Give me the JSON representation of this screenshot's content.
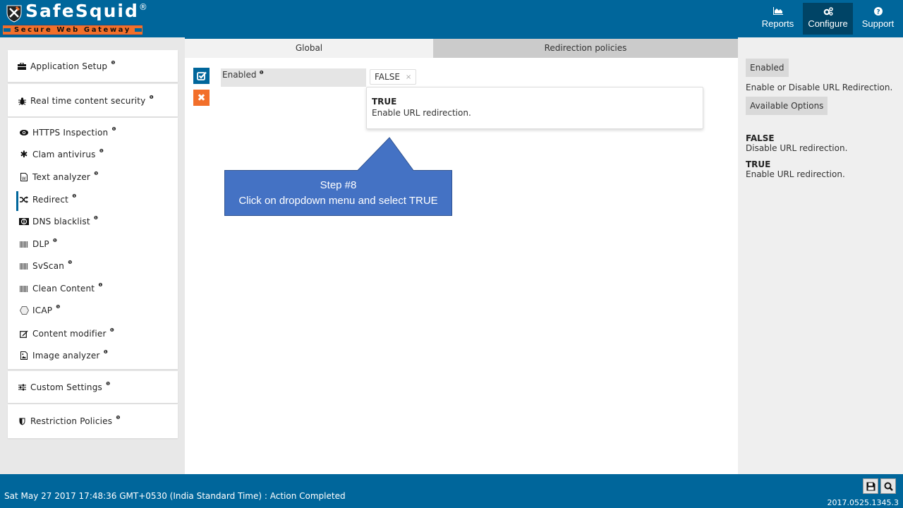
{
  "header": {
    "brand": "SafeSquid",
    "brand_mark": "®",
    "tagline": "Secure Web Gateway",
    "nav": [
      {
        "label": "Reports",
        "icon": "area-chart-icon"
      },
      {
        "label": "Configure",
        "icon": "cogs-icon",
        "active": true
      },
      {
        "label": "Support",
        "icon": "question-circle-icon"
      }
    ]
  },
  "sidebar": {
    "info_glyph": "❶",
    "groups": [
      {
        "label": "Application Setup",
        "icon": "briefcase-icon"
      },
      {
        "label": "Real time content security",
        "icon": "bug-icon"
      },
      {
        "label": "Custom Settings",
        "icon": "sliders-icon"
      },
      {
        "label": "Restriction Policies",
        "icon": "shield-icon"
      }
    ],
    "items": [
      {
        "label": "HTTPS Inspection",
        "icon": "eye-icon"
      },
      {
        "label": "Clam antivirus",
        "icon": "asterisk-icon"
      },
      {
        "label": "Text analyzer",
        "icon": "file-word-icon"
      },
      {
        "label": "Redirect",
        "icon": "random-icon",
        "active": true
      },
      {
        "label": "DNS blacklist",
        "icon": "dns-icon"
      },
      {
        "label": "DLP",
        "icon": "barcode-icon"
      },
      {
        "label": "SvScan",
        "icon": "barcode-icon"
      },
      {
        "label": "Clean Content",
        "icon": "barcode-icon"
      },
      {
        "label": "ICAP",
        "icon": "hexagon-icon"
      },
      {
        "label": "Content modifier",
        "icon": "edit-icon"
      },
      {
        "label": "Image analyzer",
        "icon": "image-icon"
      }
    ]
  },
  "main": {
    "tabs": [
      {
        "label": "Global",
        "active": true
      },
      {
        "label": "Redirection policies"
      }
    ],
    "field": {
      "label": "Enabled",
      "value": "FALSE",
      "remove_glyph": "×"
    },
    "dropdown": {
      "options": [
        {
          "title": "TRUE",
          "description": "Enable URL redirection."
        }
      ]
    },
    "callout": {
      "line1": "Step #8",
      "line2": "Click on dropdown menu and select TRUE",
      "color": "#4472c4"
    }
  },
  "rightpanel": {
    "field_name": "Enabled",
    "field_description": "Enable or Disable URL Redirection.",
    "options_heading": "Available Options",
    "options": [
      {
        "title": "FALSE",
        "description": "Disable URL redirection."
      },
      {
        "title": "TRUE",
        "description": "Enable URL redirection."
      }
    ]
  },
  "footer": {
    "status": "Sat May 27 2017 17:48:36 GMT+0530 (India Standard Time) : Action Completed",
    "version": "2017.0525.1345.3"
  },
  "colors": {
    "primary": "#00669b",
    "accent": "#f26f2a",
    "callout": "#4472c4"
  }
}
